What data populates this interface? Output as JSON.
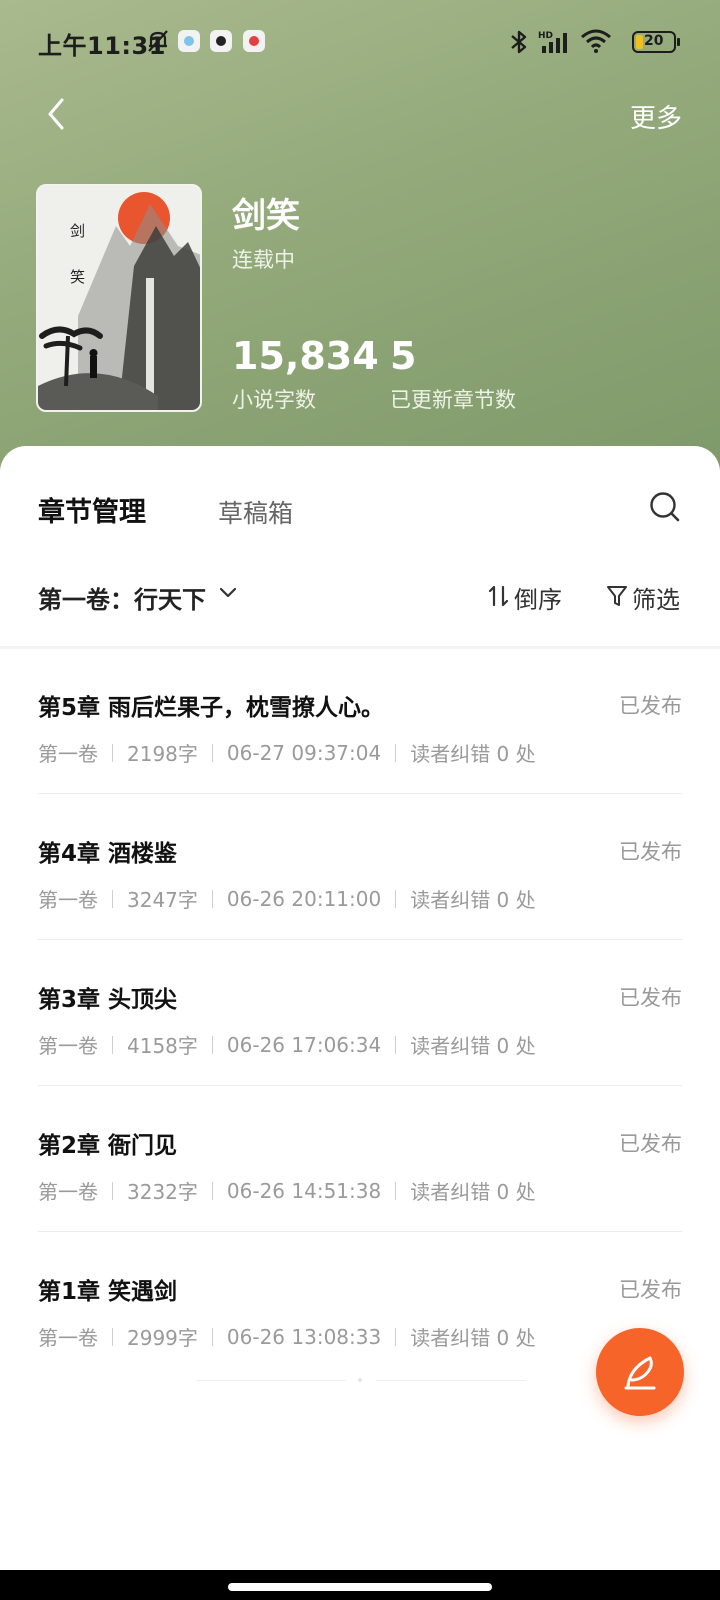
{
  "status_bar": {
    "time": "上午11:31",
    "battery": "20",
    "icons": [
      "mute-icon",
      "app-notification-icon",
      "bluetooth-icon",
      "hd-signal-icon",
      "wifi-icon",
      "battery-icon"
    ]
  },
  "header": {
    "more_label": "更多",
    "book": {
      "title": "剑笑",
      "status": "连载中",
      "cover_text": [
        "剑",
        "笑"
      ],
      "stats": [
        {
          "value": "15,834",
          "label": "小说字数"
        },
        {
          "value": "5",
          "label": "已更新章节数"
        }
      ]
    }
  },
  "tabs": [
    {
      "label": "章节管理",
      "active": true
    },
    {
      "label": "草稿箱",
      "active": false
    }
  ],
  "toolbar": {
    "volume": "第一卷：行天下",
    "sort_label": "倒序",
    "filter_label": "筛选"
  },
  "chapters": [
    {
      "title": "第5章 雨后烂果子，枕雪撩人心。",
      "state": "已发布",
      "volume": "第一卷",
      "words": "2198字",
      "time": "06-27 09:37:04",
      "errata": "读者纠错 0 处"
    },
    {
      "title": "第4章 酒楼鉴",
      "state": "已发布",
      "volume": "第一卷",
      "words": "3247字",
      "time": "06-26 20:11:00",
      "errata": "读者纠错 0 处"
    },
    {
      "title": "第3章 头顶尖",
      "state": "已发布",
      "volume": "第一卷",
      "words": "4158字",
      "time": "06-26 17:06:34",
      "errata": "读者纠错 0 处"
    },
    {
      "title": "第2章 衙门见",
      "state": "已发布",
      "volume": "第一卷",
      "words": "3232字",
      "time": "06-26 14:51:38",
      "errata": "读者纠错 0 处"
    },
    {
      "title": "第1章 笑遇剑",
      "state": "已发布",
      "volume": "第一卷",
      "words": "2999字",
      "time": "06-26 13:08:33",
      "errata": "读者纠错 0 处"
    }
  ],
  "colors": {
    "header_green": "#93a97a",
    "accent_orange": "#f7642a",
    "published_gray": "#999999"
  }
}
